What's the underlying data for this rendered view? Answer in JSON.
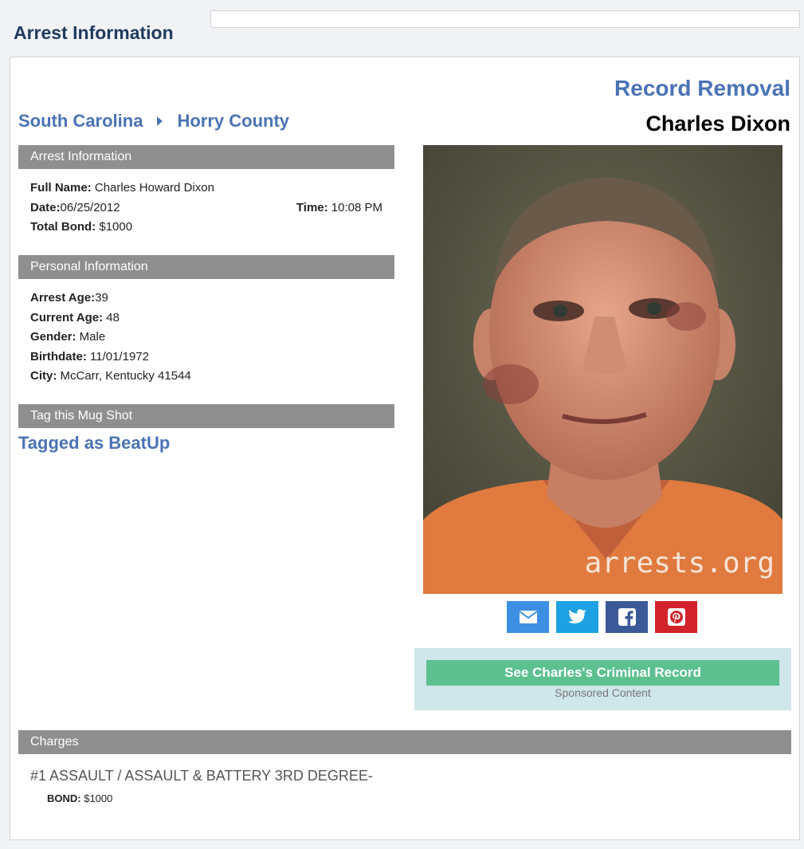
{
  "page_title": "Arrest Information",
  "record_removal": "Record Removal",
  "person_name": "Charles Dixon",
  "breadcrumb": {
    "state": "South Carolina",
    "county": "Horry County"
  },
  "arrest_section": {
    "header": "Arrest Information",
    "full_name_label": "Full Name:",
    "full_name": " Charles Howard Dixon",
    "date_label": "Date:",
    "date": "06/25/2012",
    "time_label": "Time:",
    "time": " 10:08 PM",
    "bond_label": "Total Bond:",
    "bond": " $1000"
  },
  "personal_section": {
    "header": "Personal Information",
    "arrest_age_label": "Arrest Age:",
    "arrest_age": "39",
    "current_age_label": "Current Age:",
    "current_age": " 48",
    "gender_label": "Gender:",
    "gender": " Male",
    "birthdate_label": "Birthdate:",
    "birthdate": " 11/01/1972",
    "city_label": "City:",
    "city": " McCarr, Kentucky 41544"
  },
  "tag_section": {
    "header": "Tag this Mug Shot",
    "tagged": "Tagged as BeatUp"
  },
  "mugshot": {
    "watermark": "arrests.org"
  },
  "share": {
    "email_color": "#3d8fe4",
    "twitter_color": "#1da1e2",
    "facebook_color": "#3b5998",
    "pinterest_color": "#d2232a"
  },
  "sponsor": {
    "button": "See Charles's Criminal Record",
    "note": "Sponsored Content"
  },
  "charges": {
    "header": "Charges",
    "items": [
      {
        "title": "#1 ASSAULT / ASSAULT & BATTERY 3RD DEGREE-",
        "bond_label": "BOND:",
        "bond": " $1000"
      }
    ]
  }
}
